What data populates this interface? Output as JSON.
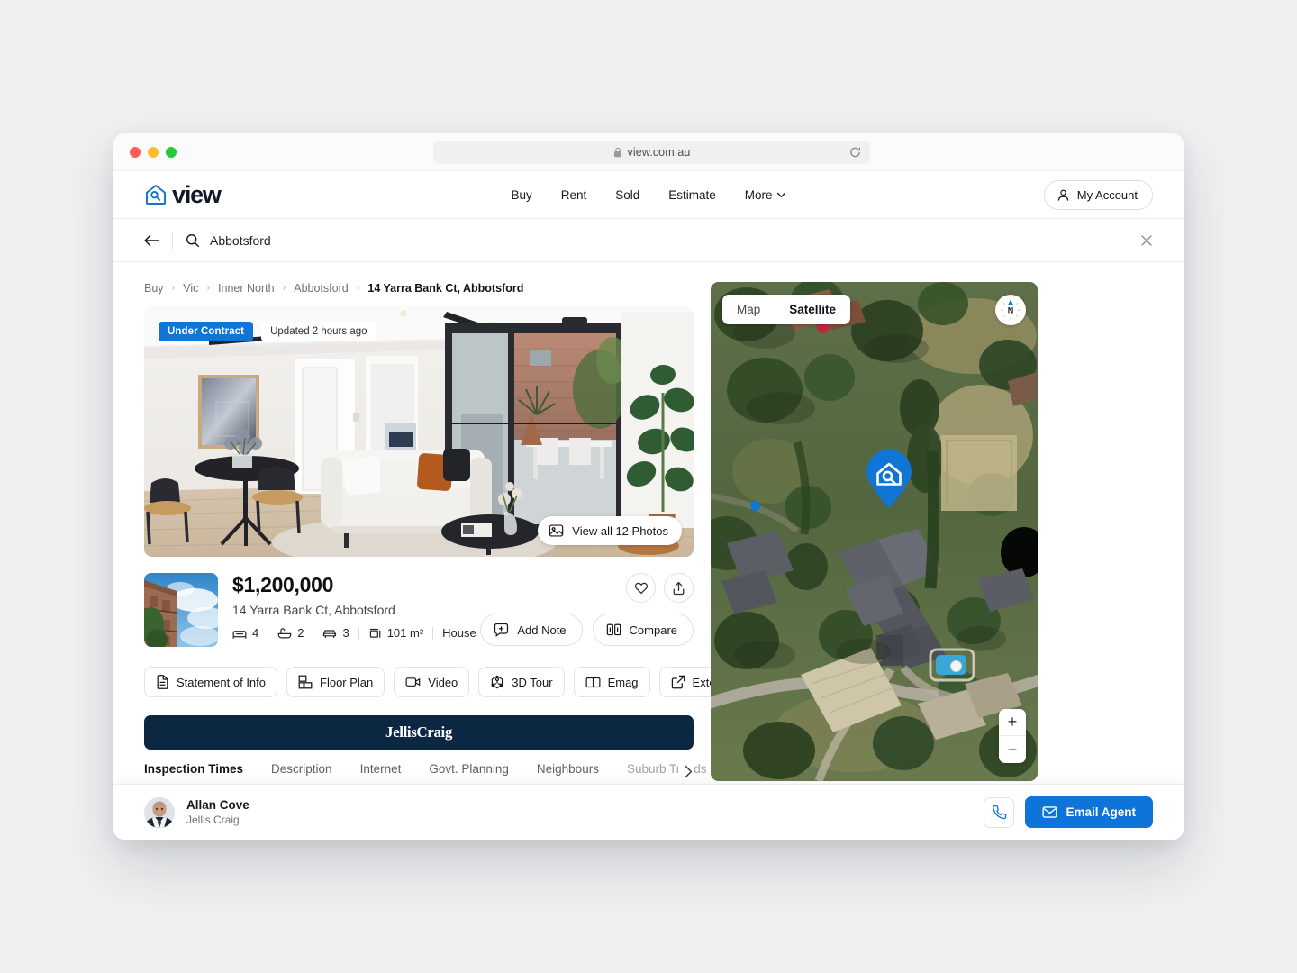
{
  "browser": {
    "url": "view.com.au",
    "lock_icon": "lock-icon",
    "reload_icon": "reload-icon"
  },
  "header": {
    "logo_text": "view",
    "logo_icon": "view-house-search-logo",
    "nav": [
      {
        "label": "Buy"
      },
      {
        "label": "Rent"
      },
      {
        "label": "Sold"
      },
      {
        "label": "Estimate"
      },
      {
        "label": "More",
        "icon": "chevron-down-icon"
      }
    ],
    "account_label": "My Account",
    "account_icon": "user-icon"
  },
  "search": {
    "value": "Abbotsford",
    "search_icon": "search-icon",
    "back_icon": "arrow-left-icon",
    "clear_icon": "close-icon"
  },
  "breadcrumb": [
    {
      "label": "Buy",
      "current": false
    },
    {
      "label": "Vic",
      "current": false
    },
    {
      "label": "Inner North",
      "current": false
    },
    {
      "label": "Abbotsford",
      "current": false
    },
    {
      "label": "14 Yarra Bank Ct, Abbotsford",
      "current": true
    }
  ],
  "hero": {
    "status_badge": "Under Contract",
    "updated_badge": "Updated 2 hours ago",
    "photos_button": "View all 12 Photos",
    "photos_icon": "image-icon",
    "alt": "Modern living room with white sofa, dining table and sliding doors"
  },
  "property": {
    "price": "$1,200,000",
    "address": "14 Yarra Bank Ct, Abbotsford",
    "thumbnail_alt": "Brick apartment building against blue sky",
    "specs": [
      {
        "icon": "bed-icon",
        "value": "4"
      },
      {
        "icon": "bath-icon",
        "value": "2"
      },
      {
        "icon": "car-icon",
        "value": "3"
      },
      {
        "icon": "area-icon",
        "value": "101 m²"
      }
    ],
    "property_type": "House",
    "favourite_icon": "heart-icon",
    "share_icon": "share-icon",
    "add_note_label": "Add Note",
    "add_note_icon": "note-plus-icon",
    "compare_label": "Compare",
    "compare_icon": "compare-icon"
  },
  "documents": [
    {
      "label": "Statement of Info",
      "icon": "document-icon"
    },
    {
      "label": "Floor Plan",
      "icon": "floorplan-icon"
    },
    {
      "label": "Video",
      "icon": "video-icon"
    },
    {
      "label": "3D Tour",
      "icon": "3d-tour-icon"
    },
    {
      "label": "Emag",
      "icon": "book-icon"
    },
    {
      "label": "External Link",
      "icon": "external-link-icon"
    }
  ],
  "agency": {
    "name": "JellisCraig",
    "banner_color": "#0b2741"
  },
  "tabs": {
    "items": [
      {
        "label": "Inspection Times",
        "active": true
      },
      {
        "label": "Description",
        "active": false
      },
      {
        "label": "Internet",
        "active": false
      },
      {
        "label": "Govt. Planning",
        "active": false
      },
      {
        "label": "Neighbours",
        "active": false
      },
      {
        "label": "Suburb Trends",
        "active": false,
        "faded": true
      }
    ],
    "next_icon": "chevron-right-icon",
    "active_color": "#1075d4"
  },
  "map": {
    "view_map_label": "Map",
    "view_satellite_label": "Satellite",
    "selected_view": "Satellite",
    "compass_label": "N",
    "compass_icon": "compass-icon",
    "zoom_in": "+",
    "zoom_out": "−",
    "pin_icon": "view-property-pin",
    "pin_color": "#1075d4"
  },
  "agent_bar": {
    "name": "Allan Cove",
    "agency": "Jellis Craig",
    "avatar_alt": "Agent headshot",
    "phone_icon": "phone-icon",
    "email_label": "Email Agent",
    "email_icon": "mail-icon",
    "email_color": "#0f74d9"
  }
}
